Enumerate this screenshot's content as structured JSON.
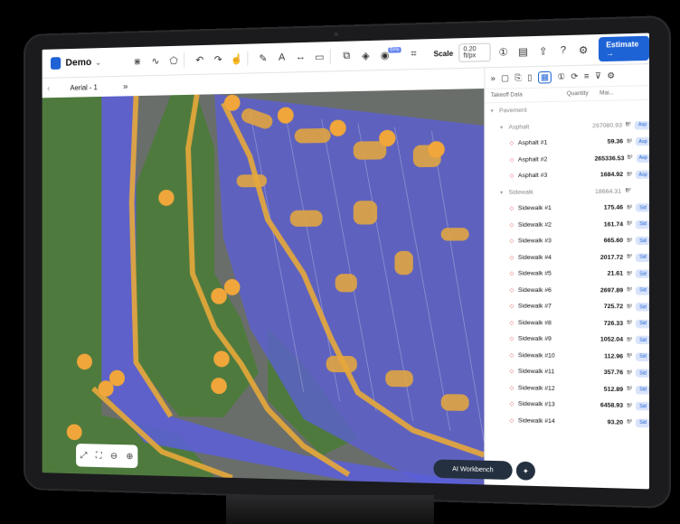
{
  "app": {
    "project_name": "Demo",
    "estimate_label": "Estimate →",
    "beta_label": "Beta",
    "scale_label": "Scale",
    "scale_value": "0.20 ft/px",
    "accent": "#1e63d6"
  },
  "sheet": {
    "name": "Aerial - 1",
    "prev": "‹",
    "next": "›",
    "expand": "»"
  },
  "toolbar_icons": [
    "select-icon",
    "polyline-icon",
    "polygon-icon",
    "undo-icon",
    "redo-icon",
    "pointer-icon",
    "pencil-icon",
    "text-icon",
    "measure-icon",
    "rectangle-icon",
    "copy-icon",
    "layers-icon",
    "ai-icon",
    "crop-icon"
  ],
  "panel": {
    "col_name": "Takeoff Data",
    "col_qty": "Quantity",
    "col_more": "Mai...",
    "rows": [
      {
        "level": 0,
        "name": "Pavement",
        "qty": "",
        "unit": "",
        "tag": "",
        "type": "group"
      },
      {
        "level": 1,
        "name": "Asphalt",
        "qty": "267080.93",
        "unit": "ft²",
        "tag": "Asp",
        "type": "group"
      },
      {
        "level": 2,
        "name": "Asphalt #1",
        "qty": "59.36",
        "unit": "ft²",
        "tag": "Asp",
        "type": "item"
      },
      {
        "level": 2,
        "name": "Asphalt #2",
        "qty": "265336.53",
        "unit": "ft²",
        "tag": "Asp",
        "type": "item"
      },
      {
        "level": 2,
        "name": "Asphalt #3",
        "qty": "1684.92",
        "unit": "ft²",
        "tag": "Asp",
        "type": "item"
      },
      {
        "level": 1,
        "name": "Sidewalk",
        "qty": "18664.31",
        "unit": "ft²",
        "tag": "",
        "type": "group"
      },
      {
        "level": 2,
        "name": "Sidewalk #1",
        "qty": "175.46",
        "unit": "ft²",
        "tag": "Sid",
        "type": "item"
      },
      {
        "level": 2,
        "name": "Sidewalk #2",
        "qty": "161.74",
        "unit": "ft²",
        "tag": "Sid",
        "type": "item"
      },
      {
        "level": 2,
        "name": "Sidewalk #3",
        "qty": "665.60",
        "unit": "ft²",
        "tag": "Sid",
        "type": "item"
      },
      {
        "level": 2,
        "name": "Sidewalk #4",
        "qty": "2017.72",
        "unit": "ft²",
        "tag": "Sid",
        "type": "item"
      },
      {
        "level": 2,
        "name": "Sidewalk #5",
        "qty": "21.61",
        "unit": "ft²",
        "tag": "Sid",
        "type": "item"
      },
      {
        "level": 2,
        "name": "Sidewalk #6",
        "qty": "2697.89",
        "unit": "ft²",
        "tag": "Sid",
        "type": "item"
      },
      {
        "level": 2,
        "name": "Sidewalk #7",
        "qty": "725.72",
        "unit": "ft²",
        "tag": "Sid",
        "type": "item"
      },
      {
        "level": 2,
        "name": "Sidewalk #8",
        "qty": "726.33",
        "unit": "ft²",
        "tag": "Sid",
        "type": "item"
      },
      {
        "level": 2,
        "name": "Sidewalk #9",
        "qty": "1052.04",
        "unit": "ft²",
        "tag": "Sid",
        "type": "item"
      },
      {
        "level": 2,
        "name": "Sidewalk #10",
        "qty": "112.96",
        "unit": "ft²",
        "tag": "Sid",
        "type": "item"
      },
      {
        "level": 2,
        "name": "Sidewalk #11",
        "qty": "357.76",
        "unit": "ft²",
        "tag": "Sid",
        "type": "item"
      },
      {
        "level": 2,
        "name": "Sidewalk #12",
        "qty": "512.89",
        "unit": "ft²",
        "tag": "Sid",
        "type": "item"
      },
      {
        "level": 2,
        "name": "Sidewalk #13",
        "qty": "6458.93",
        "unit": "ft²",
        "tag": "Sid",
        "type": "item"
      },
      {
        "level": 2,
        "name": "Sidewalk #14",
        "qty": "93.20",
        "unit": "ft²",
        "tag": "Sid",
        "type": "item"
      }
    ]
  },
  "map": {
    "workbench_label": "AI Workbench",
    "zoom_icons": [
      "fit-icon",
      "fullscreen-icon",
      "zoom-out-icon",
      "zoom-in-icon"
    ],
    "colors": {
      "grass": "#4f7a3e",
      "asphalt": "#6a6e6b",
      "takeoff_blue": "#5b5fd9",
      "sidewalk": "#e8a93a",
      "marker": "#f0a63a",
      "tag_blue": "#d9e4fb",
      "tag_text": "#1e63d6"
    }
  }
}
